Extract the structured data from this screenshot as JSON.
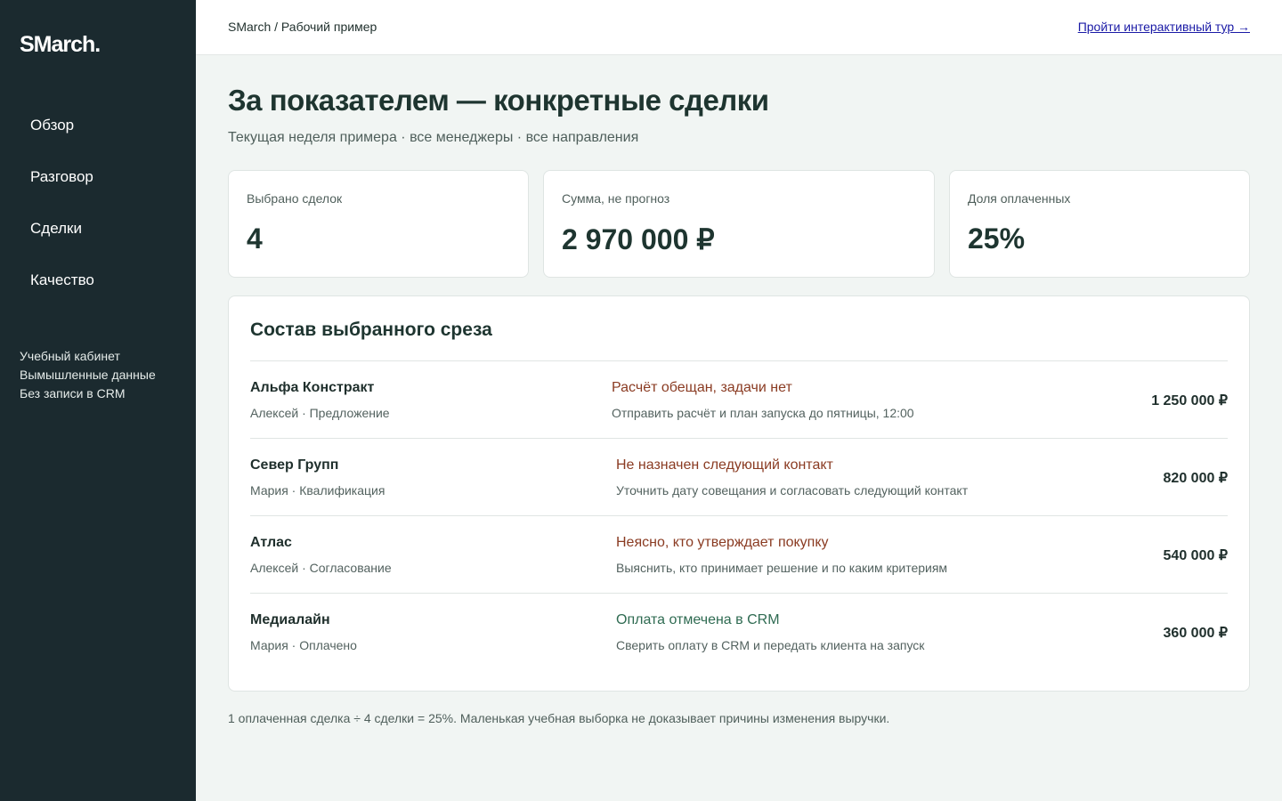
{
  "sidebar": {
    "logo": "SMarch.",
    "nav": [
      {
        "label": "Обзор"
      },
      {
        "label": "Разговор"
      },
      {
        "label": "Сделки"
      },
      {
        "label": "Качество"
      }
    ],
    "notes": [
      "Учебный кабинет",
      "Вымышленные данные",
      "Без записи в CRM"
    ]
  },
  "header": {
    "breadcrumb": "SMarch / Рабочий пример",
    "tour_link": "Пройти интерактивный тур →"
  },
  "page": {
    "title": "За показателем — конкретные сделки",
    "subtitle": "Текущая неделя примера · все менеджеры · все направления"
  },
  "stats": [
    {
      "label": "Выбрано сделок",
      "value": "4"
    },
    {
      "label": "Сумма, не прогноз",
      "value": "2 970 000 ₽"
    },
    {
      "label": "Доля оплаченных",
      "value": "25%"
    }
  ],
  "panel": {
    "title": "Состав выбранного среза",
    "rows": [
      {
        "name": "Альфа Констракт",
        "meta": "Алексей · Предложение",
        "issue": "Расчёт обещан, задачи нет",
        "action": "Отправить расчёт и план запуска до пятницы, 12:00",
        "amount": "1 250 000 ₽",
        "status": "risk"
      },
      {
        "name": "Север Групп",
        "meta": "Мария · Квалификация",
        "issue": "Не назначен следующий контакт",
        "action": "Уточнить дату совещания и согласовать следующий контакт",
        "amount": "820 000 ₽",
        "status": "risk"
      },
      {
        "name": "Атлас",
        "meta": "Алексей · Согласование",
        "issue": "Неясно, кто утверждает покупку",
        "action": "Выяснить, кто принимает решение и по каким критериям",
        "amount": "540 000 ₽",
        "status": "risk"
      },
      {
        "name": "Медиалайн",
        "meta": "Мария · Оплачено",
        "issue": "Оплата отмечена в CRM",
        "action": "Сверить оплату в CRM и передать клиента на запуск",
        "amount": "360 000 ₽",
        "status": "ok"
      }
    ]
  },
  "footnote": "1 оплаченная сделка ÷ 4 сделки = 25%. Маленькая учебная выборка не доказывает причины изменения выручки.",
  "colors": {
    "sidebar_bg": "#1b2a2f",
    "risk_text": "#8a3b22",
    "ok_text": "#2f6b52",
    "title_text": "#1e3530"
  }
}
